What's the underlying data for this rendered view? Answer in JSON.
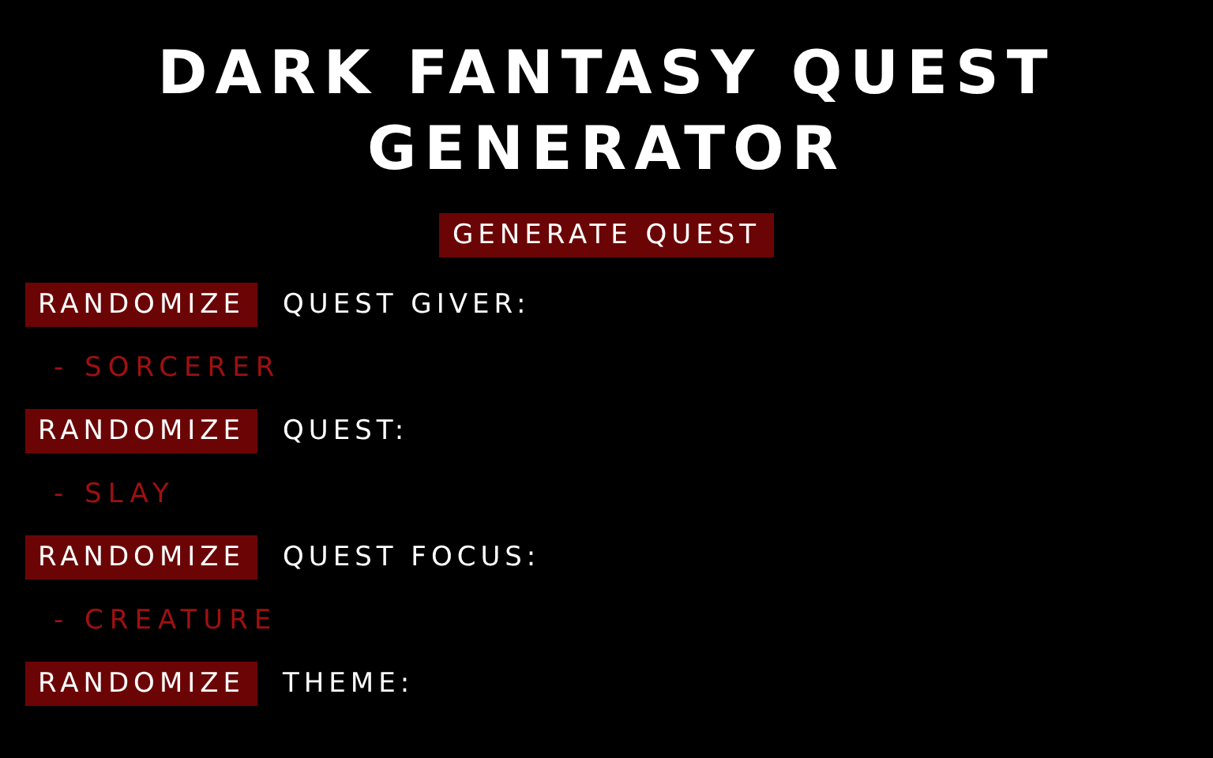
{
  "title": "DARK FANTASY QUEST GENERATOR",
  "generate_button": "GENERATE QUEST",
  "sections": [
    {
      "button": "RANDOMIZE",
      "label": "QUEST GIVER:",
      "value": "- SORCERER"
    },
    {
      "button": "RANDOMIZE",
      "label": "QUEST:",
      "value": "- SLAY"
    },
    {
      "button": "RANDOMIZE",
      "label": "QUEST FOCUS:",
      "value": "- CREATURE"
    },
    {
      "button": "RANDOMIZE",
      "label": "THEME:"
    }
  ]
}
